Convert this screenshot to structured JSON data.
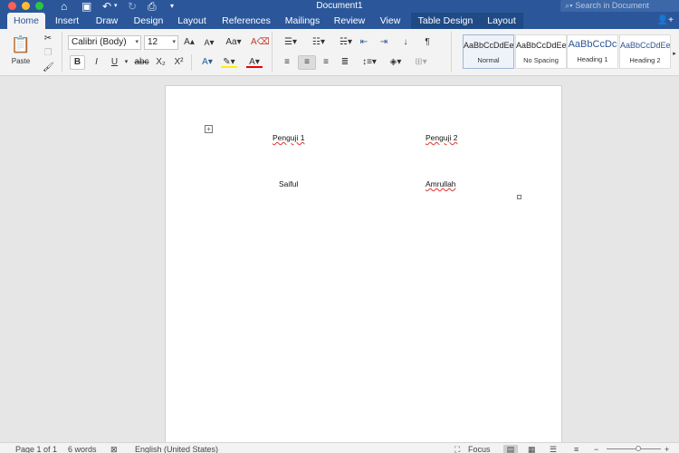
{
  "window": {
    "title": "Document1",
    "search_placeholder": "Search in Document"
  },
  "tabs": [
    "Home",
    "Insert",
    "Draw",
    "Design",
    "Layout",
    "References",
    "Mailings",
    "Review",
    "View",
    "Table Design",
    "Layout"
  ],
  "ribbon": {
    "paste_label": "Paste",
    "font_name": "Calibri (Body)",
    "font_size": "12",
    "bold": "B",
    "italic": "I",
    "underline": "U",
    "strikethrough": "abc",
    "subscript": "X₂",
    "superscript": "X²",
    "grow_font": "A",
    "shrink_font": "A",
    "change_case": "Aa",
    "font_color_glyph": "A",
    "pilcrow": "¶",
    "styles": [
      {
        "sample": "AaBbCcDdEe",
        "name": "Normal"
      },
      {
        "sample": "AaBbCcDdEe",
        "name": "No Spacing"
      },
      {
        "sample": "AaBbCcDc",
        "name": "Heading 1"
      },
      {
        "sample": "AaBbCcDdEe",
        "name": "Heading 2"
      }
    ],
    "colors": {
      "highlight": "#ffef00",
      "font_color": "#e00000"
    }
  },
  "document": {
    "table": [
      [
        "Penguji 1",
        "Penguji 2"
      ],
      [
        "Saiful",
        "Amrullah"
      ]
    ]
  },
  "statusbar": {
    "page": "Page 1 of 1",
    "words": "6 words",
    "language": "English (United States)",
    "focus": "Focus"
  }
}
